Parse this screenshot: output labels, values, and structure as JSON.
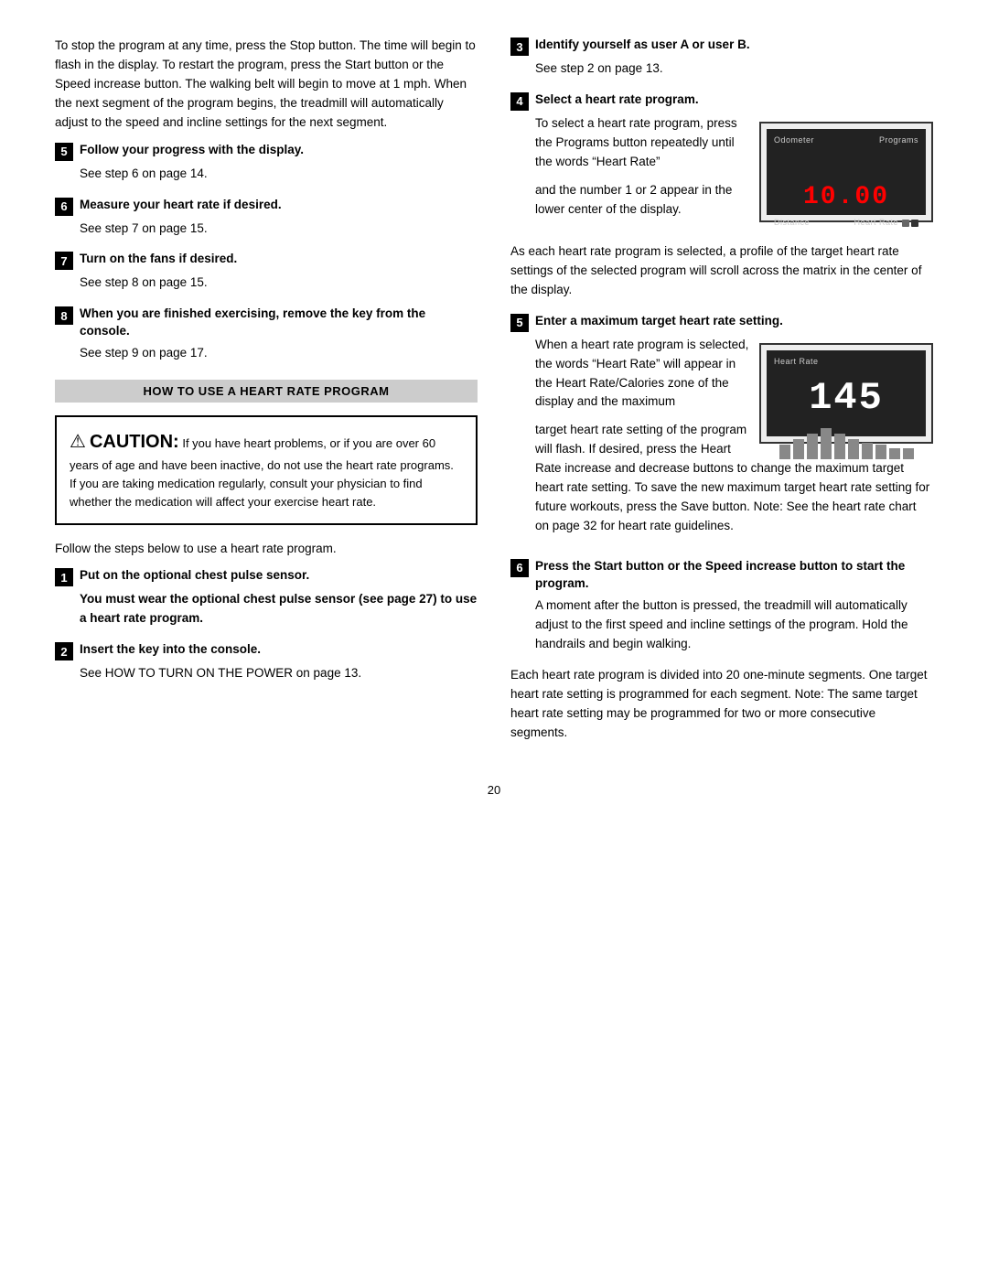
{
  "intro_paragraph": "To stop the program at any time, press the Stop button. The time will begin to flash in the display. To restart the program, press the Start button or the Speed increase button. The walking belt will begin to move at 1 mph. When the next segment of the program begins, the treadmill will automatically adjust to the speed and incline settings for the next segment.",
  "left_steps": [
    {
      "num": "5",
      "title": "Follow your progress with the display.",
      "body": "See step 6 on page 14."
    },
    {
      "num": "6",
      "title": "Measure your heart rate if desired.",
      "body": "See step 7 on page 15."
    },
    {
      "num": "7",
      "title": "Turn on the fans if desired.",
      "body": "See step 8 on page 15."
    },
    {
      "num": "8",
      "title": "When you are finished exercising, remove the key from the console.",
      "body": "See step 9 on page 17."
    }
  ],
  "section_header": "HOW TO USE A HEART RATE PROGRAM",
  "caution": {
    "title": "CAUTION:",
    "text": "If you have heart problems, or if you are over 60 years of age and have been inactive, do not use the heart rate programs. If you are taking medication regularly, consult your physician to find whether the medication will affect your exercise heart rate."
  },
  "follow_steps_text": "Follow the steps below to use a heart rate program.",
  "heart_steps_left": [
    {
      "num": "1",
      "title": "Put on the optional chest pulse sensor.",
      "bold_body": "You must wear the optional chest pulse sensor (see page 27) to use a heart rate program."
    },
    {
      "num": "2",
      "title": "Insert the key into the console.",
      "body": "See HOW TO TURN ON THE POWER on page 13."
    }
  ],
  "right_steps": [
    {
      "num": "3",
      "title": "Identify yourself as user A or user B.",
      "body": "See step 2 on page 13."
    },
    {
      "num": "4",
      "title": "Select a heart rate program.",
      "body_pre": "To select a heart rate program, press the Programs button repeatedly until the words “Heart Rate”",
      "body_post": "and the number 1 or 2 appear in the lower center of the display.",
      "display": {
        "label_left": "Odometer",
        "label_right": "Programs",
        "number": "10.00",
        "label_bottom_left": "Distance",
        "label_bottom_right": "Heart Rate",
        "dots": 2
      }
    },
    {
      "num": "",
      "paragraph1": "As each heart rate program is selected, a profile of the target heart rate settings of the selected program will scroll across the matrix in the center of the display."
    },
    {
      "num": "5",
      "title": "Enter a maximum target heart rate setting.",
      "body_pre": "When a heart rate program is selected, the words “Heart Rate” will appear in the Heart Rate/Calories zone of the display and the maximum",
      "body_post": "target heart rate setting of the program will flash. If desired, press the Heart Rate increase and decrease buttons to change the maximum target heart rate setting. To save the new maximum target heart rate setting for future workouts, press the Save button. Note: See the heart rate chart on page 32 for heart rate guidelines.",
      "display": {
        "label": "Heart Rate",
        "number": "145",
        "bars": [
          4,
          6,
          8,
          10,
          8,
          6,
          5,
          4,
          3,
          3
        ]
      }
    },
    {
      "num": "6",
      "title": "Press the Start button or the Speed increase button to start the program.",
      "body": "A moment after the button is pressed, the treadmill will automatically adjust to the first speed and incline settings of the program. Hold the handrails and begin walking."
    },
    {
      "num": "",
      "paragraph1": "Each heart rate program is divided into 20 one-minute segments. One target heart rate setting is programmed for each segment. Note: The same target heart rate setting may be programmed for two or more consecutive segments."
    }
  ],
  "page_number": "20"
}
